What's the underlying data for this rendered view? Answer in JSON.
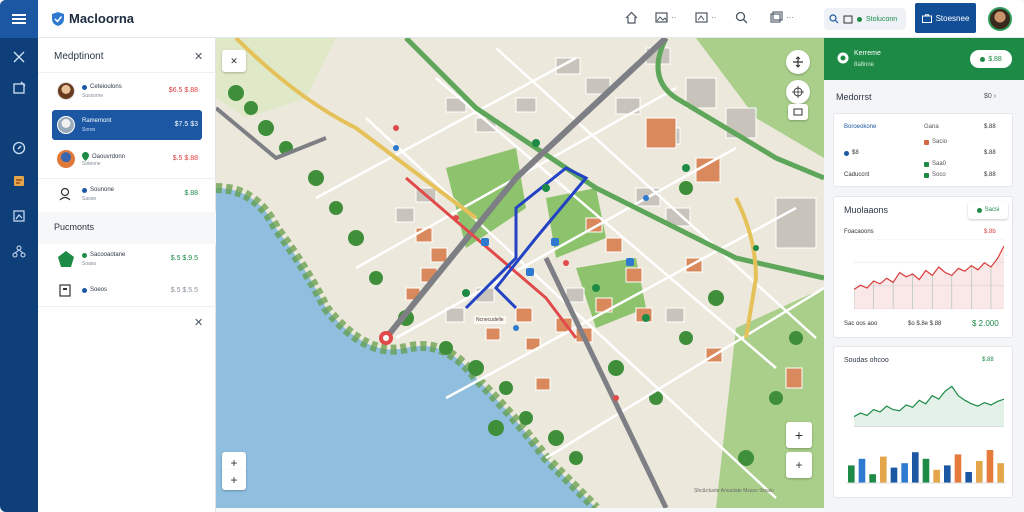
{
  "app": {
    "title": "Macloorna"
  },
  "colors": {
    "brand": "#124e96",
    "rail": "#0f3f78",
    "accent_green": "#1d8a46",
    "red": "#d93b3b"
  },
  "header": {
    "icons": [
      {
        "name": "home-icon",
        "label": ""
      },
      {
        "name": "image-icon",
        "label": "··"
      },
      {
        "name": "gallery-icon",
        "label": "··"
      },
      {
        "name": "search-icon",
        "label": ""
      },
      {
        "name": "layers-icon",
        "label": "···"
      }
    ],
    "search_label": "Stoluconn",
    "primary_label": "Stoesnee"
  },
  "left_panel": {
    "title": "Medptinont",
    "items": [
      {
        "title": "Ceteioulons",
        "sub": "Sussorne",
        "value": "$6.5 $.88",
        "value_color": "#d93b3b",
        "dot": "#1b57a2",
        "selected": false
      },
      {
        "title": "Ramemont",
        "sub": "Soroo",
        "value": "$7.5 $3",
        "value_color": "#ffffff",
        "dot": "#ffffff",
        "selected": true
      },
      {
        "title": "Oaouvrdonn",
        "sub": "Soteone",
        "value": "$.5 $.88",
        "value_color": "#d93b3b",
        "dot": "#1d8a46",
        "selected": false
      },
      {
        "title": "Sounone",
        "sub": "Saose",
        "value": "$.88",
        "value_color": "#1d8a46",
        "dot": "#1b57a2",
        "selected": false
      }
    ],
    "section_title": "Pucmonts",
    "items2": [
      {
        "title": "Sacooaotane",
        "sub": "Soaso",
        "value": "$.5 $.9.5",
        "value_color": "#1d8a46",
        "dot": "#1d8a46"
      },
      {
        "title": "Soeos",
        "sub": "",
        "value": "$.5 $.5.5",
        "value_color": "#8a929c",
        "dot": "#1b57a2"
      }
    ]
  },
  "map": {
    "footer": "Shc&ctuote  Anusdate   Msaxo  9ssaiu",
    "tooltip": "Ncnecudelle"
  },
  "right_panel": {
    "top_title": "Kerreme",
    "top_sub": "8a8nne",
    "top_pill": "$.88",
    "section_title": "Medorrst",
    "section_value": "$0",
    "card1": {
      "head_left": "Boroeokone",
      "head_mid": "Gana",
      "head_right": "$.88",
      "rows": [
        {
          "left": "$8",
          "mid": "Sacio",
          "right": "$.88",
          "dot": "#d26a3f"
        },
        {
          "left": "",
          "mid": "Saa0",
          "right": "$.08",
          "dot": "#1d8a46"
        },
        {
          "left": "Caduccnt",
          "mid": "Soco",
          "right": "$.88",
          "dot": "#1d8a46"
        }
      ]
    },
    "card2": {
      "title": "Muolaaons",
      "pill": "Sacsi",
      "sub": "Foacaoons",
      "sub_value": "$.8b",
      "foot_left": "Sac oos aoo",
      "foot_mid": "$o  $.8e  $.88",
      "foot_right": "$ 2.000"
    },
    "card3": {
      "title": "Soudas ohcoo",
      "value": "$.88"
    }
  },
  "chart_data": [
    {
      "type": "area",
      "x": [
        0,
        1,
        2,
        3,
        4,
        5,
        6,
        7,
        8,
        9,
        10,
        11,
        12,
        13,
        14,
        15,
        16,
        17,
        18,
        19,
        20,
        21,
        22,
        23
      ],
      "values": [
        28,
        34,
        30,
        40,
        36,
        44,
        38,
        52,
        46,
        50,
        42,
        55,
        48,
        60,
        52,
        48,
        58,
        54,
        62,
        56,
        66,
        60,
        72,
        90
      ],
      "color": "#d93b3b",
      "ylim": [
        0,
        100
      ]
    },
    {
      "type": "line",
      "values": [
        18,
        24,
        20,
        30,
        26,
        36,
        30,
        28,
        38,
        34,
        46,
        40,
        54,
        48,
        62,
        70,
        54,
        46,
        40,
        36,
        42,
        38,
        44,
        48
      ],
      "color": "#1d8a46",
      "ylim": [
        0,
        100
      ]
    },
    {
      "type": "bar",
      "values": [
        40,
        55,
        20,
        60,
        35,
        45,
        70,
        55,
        30,
        40,
        65,
        25,
        50,
        75,
        45
      ],
      "colors": [
        "#1d8a46",
        "#2e7ad1",
        "#1d8a46",
        "#e5a54a",
        "#1b57a2",
        "#2e7ad1",
        "#1b57a2",
        "#1d8a46",
        "#e5a54a",
        "#1b57a2",
        "#e57a3a",
        "#1b57a2",
        "#e5a54a",
        "#e57a3a",
        "#e5a54a"
      ],
      "ylim": [
        0,
        100
      ]
    }
  ]
}
